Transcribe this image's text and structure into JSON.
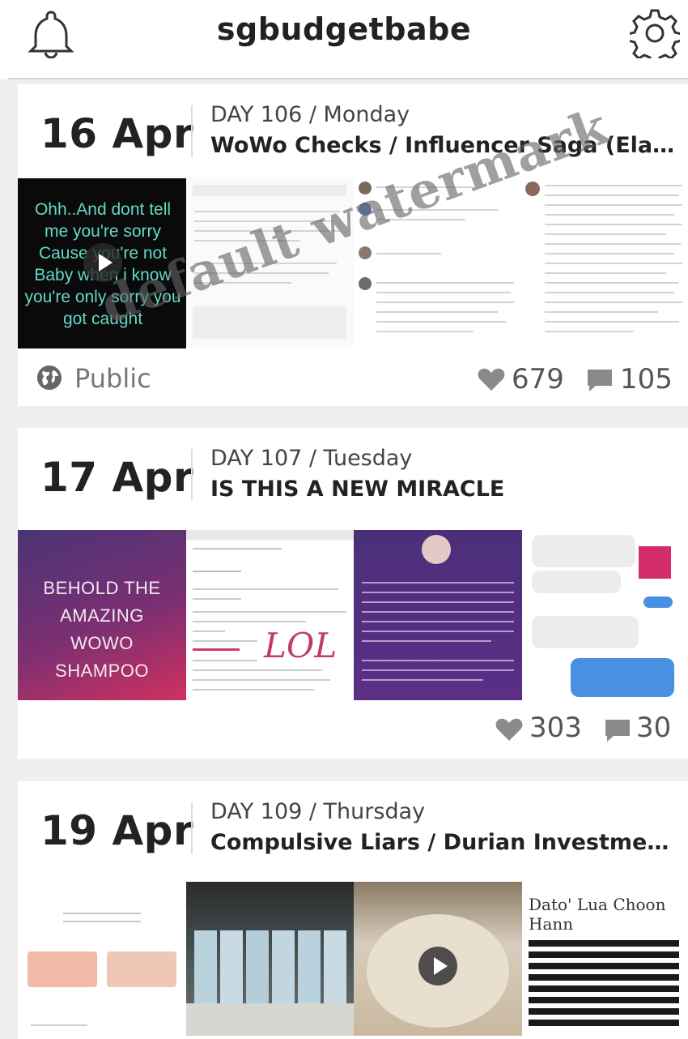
{
  "app": {
    "title": "sgbudgetbabe"
  },
  "icons": {
    "notifications": "bell-icon",
    "settings": "gear-icon",
    "likes": "heart-icon",
    "comments": "comment-icon",
    "visibility": "globe-icon",
    "video": "play-icon"
  },
  "colors": {
    "text": "#222222",
    "muted": "#555555",
    "feed_bg": "#efefef",
    "card_bg": "#ffffff",
    "purple_gradient_start": "#4a3476",
    "purple_gradient_end": "#d0315f"
  },
  "watermark": {
    "text": "default watermark"
  },
  "posts": [
    {
      "date": "16 Apr",
      "day_label": "DAY 106 / Monday",
      "title": "WoWo Checks / Influencer Saga (Elaine J...",
      "visibility": "Public",
      "likes": "679",
      "comments": "105",
      "image_text": "Ohh..And dont tell me you're sorry Cause you're not Baby when i know you're only sorry you got caught"
    },
    {
      "date": "17 Apr",
      "day_label": "DAY 107 / Tuesday",
      "title": "IS THIS A NEW MIRACLE",
      "likes": "303",
      "comments": "30",
      "image_text": "BEHOLD THE AMAZING WOWO SHAMPOO",
      "handwriting": "LOL"
    },
    {
      "date": "19 Apr",
      "day_label": "DAY 109 / Thursday",
      "title": "Compulsive Liars / Durian Investments ...",
      "image_text": "Dato' Lua Choon Hann"
    }
  ]
}
